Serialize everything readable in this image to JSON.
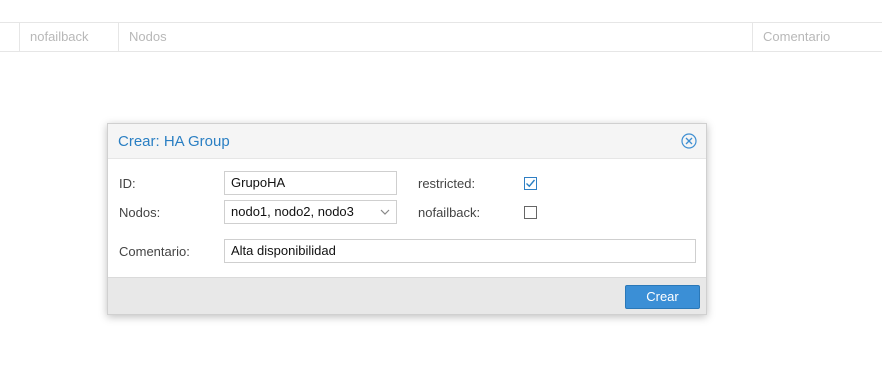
{
  "grid": {
    "columns": [
      "nofailback",
      "Nodos",
      "Comentario"
    ]
  },
  "dialog": {
    "title": "Crear: HA Group",
    "close_icon": "close-circle-icon",
    "fields": {
      "id_label": "ID:",
      "id_value": "GrupoHA",
      "nodos_label": "Nodos:",
      "nodos_value": "nodo1, nodo2, nodo3",
      "comentario_label": "Comentario:",
      "comentario_value": "Alta disponibilidad",
      "restricted_label": "restricted:",
      "restricted_checked": true,
      "nofailback_label": "nofailback:",
      "nofailback_checked": false
    },
    "submit_label": "Crear"
  },
  "colors": {
    "accent": "#2a7fc3",
    "button": "#3b8fd6",
    "footer": "#e8e8e8"
  }
}
